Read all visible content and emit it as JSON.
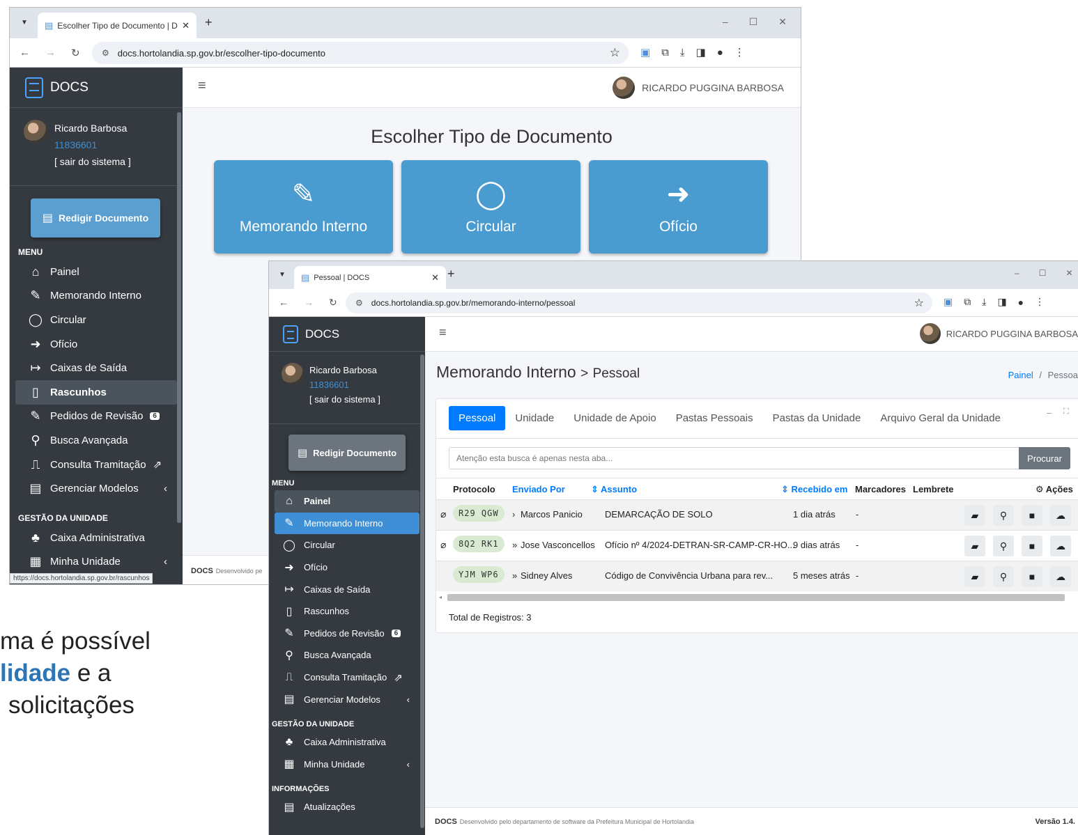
{
  "win1": {
    "tab_title": "Escolher Tipo de Documento | D",
    "url": "docs.hortolandia.sp.gov.br/escolher-tipo-documento",
    "brand": "DOCS",
    "user": {
      "name": "Ricardo Barbosa",
      "id": "11836601",
      "logout": "[ sair do sistema ]"
    },
    "redigir": "Redigir Documento",
    "menu_header": "MENU",
    "menu": [
      {
        "icon": "home-icon",
        "glyph": "⌂",
        "label": "Painel"
      },
      {
        "icon": "memo-icon",
        "glyph": "✎",
        "label": "Memorando Interno"
      },
      {
        "icon": "circle-icon",
        "glyph": "◯",
        "label": "Circular"
      },
      {
        "icon": "oficio-icon",
        "glyph": "➜",
        "label": "Ofício"
      },
      {
        "icon": "outbox-icon",
        "glyph": "↦",
        "label": "Caixas de Saída"
      },
      {
        "icon": "draft-icon",
        "glyph": "▯",
        "label": "Rascunhos",
        "active": true
      },
      {
        "icon": "review-icon",
        "glyph": "✎",
        "label": "Pedidos de Revisão",
        "badge": "6"
      },
      {
        "icon": "search-icon",
        "glyph": "⚲",
        "label": "Busca Avançada"
      },
      {
        "icon": "pulse-icon",
        "glyph": "⎍",
        "label": "Consulta Tramitação",
        "ext": "⇗"
      },
      {
        "icon": "template-icon",
        "glyph": "▤",
        "label": "Gerenciar Modelos",
        "chev": "‹"
      }
    ],
    "gestao_header": "GESTÃO DA UNIDADE",
    "gestao": [
      {
        "icon": "sitemap-icon",
        "glyph": "♣",
        "label": "Caixa Administrativa"
      },
      {
        "icon": "building-icon",
        "glyph": "▦",
        "label": "Minha Unidade",
        "chev": "‹"
      }
    ],
    "top_user": "RICARDO PUGGINA BARBOSA",
    "page_title": "Escolher Tipo de Documento",
    "cards": [
      {
        "icon": "memo-icon",
        "glyph": "✎",
        "label": "Memorando Interno"
      },
      {
        "icon": "circular-icon",
        "glyph": "◯",
        "label": "Circular"
      },
      {
        "icon": "oficio-icon",
        "glyph": "➜",
        "label": "Ofício"
      }
    ],
    "status_url": "https://docs.hortolandia.sp.gov.br/rascunhos",
    "footer_brand": "DOCS",
    "footer_text": "Desenvolvido pe"
  },
  "bg_text": {
    "line1": "ma é possível",
    "line2_hl": "lidade",
    "line2_rest": " e a",
    "line3": "solicitações"
  },
  "win2": {
    "tab_title": "Pessoal | DOCS",
    "url": "docs.hortolandia.sp.gov.br/memorando-interno/pessoal",
    "brand": "DOCS",
    "user": {
      "name": "Ricardo Barbosa",
      "id": "11836601",
      "logout": "[ sair do sistema ]"
    },
    "redigir": "Redigir Documento",
    "menu_header": "MENU",
    "menu": [
      {
        "icon": "home-icon",
        "glyph": "⌂",
        "label": "Painel",
        "active": true
      },
      {
        "icon": "memo-icon",
        "glyph": "✎",
        "label": "Memorando Interno",
        "blue": true
      },
      {
        "icon": "circle-icon",
        "glyph": "◯",
        "label": "Circular"
      },
      {
        "icon": "oficio-icon",
        "glyph": "➜",
        "label": "Ofício"
      },
      {
        "icon": "outbox-icon",
        "glyph": "↦",
        "label": "Caixas de Saída"
      },
      {
        "icon": "draft-icon",
        "glyph": "▯",
        "label": "Rascunhos"
      },
      {
        "icon": "review-icon",
        "glyph": "✎",
        "label": "Pedidos de Revisão",
        "badge": "6"
      },
      {
        "icon": "search-icon",
        "glyph": "⚲",
        "label": "Busca Avançada"
      },
      {
        "icon": "pulse-icon",
        "glyph": "⎍",
        "label": "Consulta Tramitação",
        "ext": "⇗"
      },
      {
        "icon": "template-icon",
        "glyph": "▤",
        "label": "Gerenciar Modelos",
        "chev": "‹"
      }
    ],
    "gestao_header": "GESTÃO DA UNIDADE",
    "gestao": [
      {
        "icon": "sitemap-icon",
        "glyph": "♣",
        "label": "Caixa Administrativa"
      },
      {
        "icon": "building-icon",
        "glyph": "▦",
        "label": "Minha Unidade",
        "chev": "‹"
      }
    ],
    "info_header": "INFORMAÇÕES",
    "info": [
      {
        "icon": "news-icon",
        "glyph": "▤",
        "label": "Atualizações"
      }
    ],
    "top_user": "RICARDO PUGGINA BARBOSA",
    "title_main": "Memorando Interno",
    "title_sep": ">",
    "title_sub": "Pessoal",
    "breadcrumb_link": "Painel",
    "breadcrumb_sep": "/",
    "breadcrumb_current": "Pessoa",
    "tabs": [
      "Pessoal",
      "Unidade",
      "Unidade de Apoio",
      "Pastas Pessoais",
      "Pastas da Unidade",
      "Arquivo Geral da Unidade"
    ],
    "search_placeholder": "Atenção esta busca é apenas nesta aba...",
    "search_button": "Procurar",
    "columns": {
      "protocolo": "Protocolo",
      "enviado": "Enviado Por",
      "assunto": "Assunto",
      "recebido": "Recebido em",
      "marcadores": "Marcadores",
      "lembrete": "Lembrete",
      "acoes": "Ações"
    },
    "rows": [
      {
        "attach": "⌀",
        "protocolo": "R29 QGW",
        "arrow": "›",
        "enviado": "Marcos Panicio",
        "assunto": "DEMARCAÇÃO DE SOLO",
        "recebido": "1 dia atrás",
        "marcadores": "-"
      },
      {
        "attach": "⌀",
        "protocolo": "8Q2 RK1",
        "arrow": "»",
        "enviado": "Jose Vasconcellos",
        "assunto": "Ofício nº 4/2024-DETRAN-SR-CAMP-CR-HO...",
        "recebido": "9 dias atrás",
        "marcadores": "-"
      },
      {
        "attach": "",
        "protocolo": "YJM WP6",
        "arrow": "»",
        "enviado": "Sidney Alves",
        "assunto": "Código de Convivência Urbana para rev...",
        "recebido": "5 meses atrás",
        "marcadores": "-"
      }
    ],
    "total": "Total de Registros: 3",
    "footer_brand": "DOCS",
    "footer_text": "Desenvolvido pelo departamento de software da Prefeitura Municipal de Hortolandia",
    "version": "Versão 1.4."
  }
}
